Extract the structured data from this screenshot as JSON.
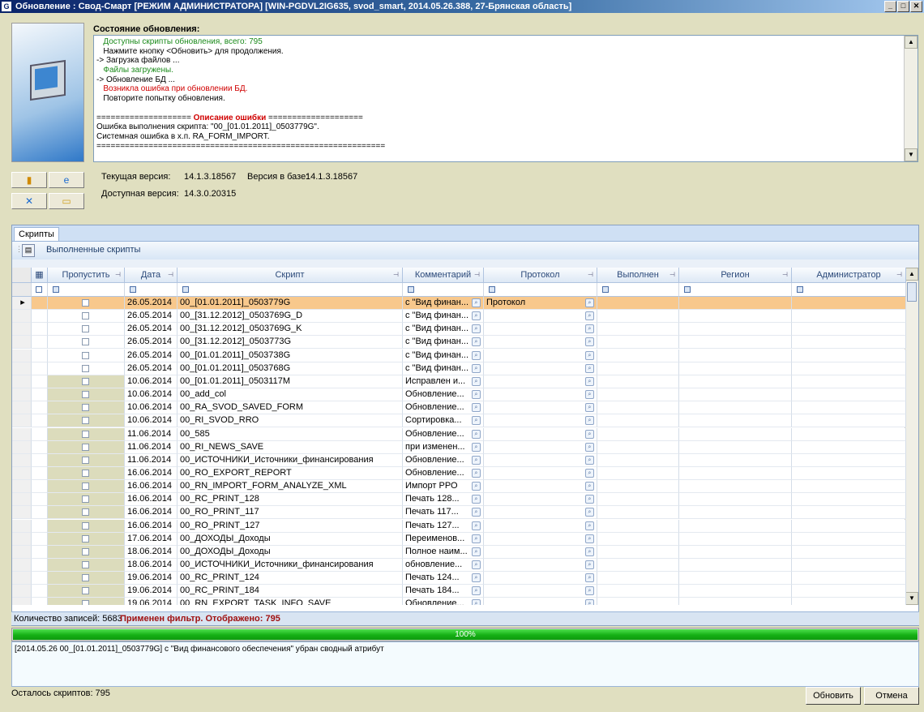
{
  "window": {
    "title": "Обновление : Свод-Смарт [РЕЖИМ АДМИНИСТРАТОРА] [WIN-PGDVL2IG635, svod_smart, 2014.05.26.388, 27-Брянская область]",
    "minimize": "_",
    "maximize": "□",
    "close": "✕"
  },
  "status": {
    "label": "Состояние обновления:",
    "lines": [
      {
        "text": "   Доступны скрипты обновления, всего: 795",
        "color": "#1a8a1a"
      },
      {
        "text": "   Нажмите кнопку <Обновить> для продолжения.",
        "color": "#000000"
      },
      {
        "text": "-> Загрузка файлов ...",
        "color": "#000000"
      },
      {
        "text": "   Файлы загружены.",
        "color": "#1a8a1a"
      },
      {
        "text": "-> Обновление БД ...",
        "color": "#000000"
      },
      {
        "text": "   Возникла ошибка при обновлении БД.",
        "color": "#d00000"
      },
      {
        "text": "   Повторите попытку обновления.",
        "color": "#000000"
      },
      {
        "text": "",
        "color": "#000000"
      },
      {
        "text": "==================== ",
        "color": "#000000",
        "bold_part": "Описание ошибки",
        "tail": " ===================="
      },
      {
        "text": "Ошибка выполнения скрипта: \"00_[01.01.2011]_0503779G\".",
        "color": "#000000"
      },
      {
        "text": "Системная ошибка в х.п. RA_FORM_IMPORT.",
        "color": "#000000"
      },
      {
        "text": "=============================================================",
        "color": "#000000"
      }
    ]
  },
  "version": {
    "current_label": "Текущая версия:",
    "current_value": "14.1.3.18567",
    "db_label": "Версия в базе:",
    "db_value": "14.1.3.18567",
    "available_label": "Доступная версия:",
    "available_value": "14.3.0.20315"
  },
  "tabs": {
    "scripts": "Скрипты"
  },
  "toolbar": {
    "executed_scripts": "Выполненные скрипты"
  },
  "columns": [
    "Пропустить",
    "Дата",
    "Скрипт",
    "Комментарий",
    "Протокол",
    "Выполнен",
    "Регион",
    "Администратор"
  ],
  "rows": [
    {
      "date": "26.05.2014",
      "script": "00_[01.01.2011]_0503779G",
      "comment": "с \"Вид финан...",
      "protocol": "Протокол",
      "selected": true
    },
    {
      "date": "26.05.2014",
      "script": "00_[31.12.2012]_0503769G_D",
      "comment": "с \"Вид финан...",
      "protocol": ""
    },
    {
      "date": "26.05.2014",
      "script": "00_[31.12.2012]_0503769G_K",
      "comment": "с \"Вид финан...",
      "protocol": ""
    },
    {
      "date": "26.05.2014",
      "script": "00_[31.12.2012]_0503773G",
      "comment": "с \"Вид финан...",
      "protocol": ""
    },
    {
      "date": "26.05.2014",
      "script": "00_[01.01.2011]_0503738G",
      "comment": "с \"Вид финан...",
      "protocol": ""
    },
    {
      "date": "26.05.2014",
      "script": "00_[01.01.2011]_0503768G",
      "comment": "с \"Вид финан...",
      "protocol": ""
    },
    {
      "date": "10.06.2014",
      "script": "00_[01.01.2011]_0503117M",
      "comment": "Исправлен и...",
      "protocol": ""
    },
    {
      "date": "10.06.2014",
      "script": "00_add_col",
      "comment": "Обновление...",
      "protocol": ""
    },
    {
      "date": "10.06.2014",
      "script": "00_RA_SVOD_SAVED_FORM",
      "comment": "Обновление...",
      "protocol": ""
    },
    {
      "date": "10.06.2014",
      "script": "00_RI_SVOD_RRO",
      "comment": "Сортировка...",
      "protocol": ""
    },
    {
      "date": "11.06.2014",
      "script": "00_585",
      "comment": "Обновление...",
      "protocol": ""
    },
    {
      "date": "11.06.2014",
      "script": "00_RI_NEWS_SAVE",
      "comment": "при изменен...",
      "protocol": ""
    },
    {
      "date": "11.06.2014",
      "script": "00_ИСТОЧНИКИ_Источники_финансирования",
      "comment": "Обновление...",
      "protocol": ""
    },
    {
      "date": "16.06.2014",
      "script": "00_RO_EXPORT_REPORT",
      "comment": "Обновление...",
      "protocol": ""
    },
    {
      "date": "16.06.2014",
      "script": "00_RN_IMPORT_FORM_ANALYZE_XML",
      "comment": "Импорт РРО",
      "protocol": ""
    },
    {
      "date": "16.06.2014",
      "script": "00_RC_PRINT_128",
      "comment": "Печать 128...",
      "protocol": ""
    },
    {
      "date": "16.06.2014",
      "script": "00_RO_PRINT_117",
      "comment": "Печать 117...",
      "protocol": ""
    },
    {
      "date": "16.06.2014",
      "script": "00_RO_PRINT_127",
      "comment": "Печать 127...",
      "protocol": ""
    },
    {
      "date": "17.06.2014",
      "script": "00_ДОХОДЫ_Доходы",
      "comment": "Переименов...",
      "protocol": ""
    },
    {
      "date": "18.06.2014",
      "script": "00_ДОХОДЫ_Доходы",
      "comment": "Полное наим...",
      "protocol": ""
    },
    {
      "date": "18.06.2014",
      "script": "00_ИСТОЧНИКИ_Источники_финансирования",
      "comment": "обновление...",
      "protocol": ""
    },
    {
      "date": "19.06.2014",
      "script": "00_RC_PRINT_124",
      "comment": "Печать 124...",
      "protocol": ""
    },
    {
      "date": "19.06.2014",
      "script": "00_RC_PRINT_184",
      "comment": "Печать 184...",
      "protocol": ""
    },
    {
      "date": "19.06.2014",
      "script": "00_RN_EXPORT_TASK_INFO_SAVE",
      "comment": "Обновление...",
      "protocol": ""
    }
  ],
  "statusbar": {
    "count_text": "Количество записей: 5683",
    "filter_text": "Применен фильтр. Отображено: 795"
  },
  "progress": {
    "value": 1.0,
    "label": "100%"
  },
  "message": "[2014.05.26 00_[01.01.2011]_0503779G] с  \"Вид финансового обеспечения\" убран сводный атрибут",
  "footer": {
    "remaining": "Осталось скриптов: 795",
    "update_button": "Обновить",
    "cancel_button": "Отмена"
  },
  "colors": {
    "selected_row": "#f8c88c",
    "skipped_col": "#dcdcbc",
    "error": "#d00000",
    "ok": "#1a8a1a"
  }
}
